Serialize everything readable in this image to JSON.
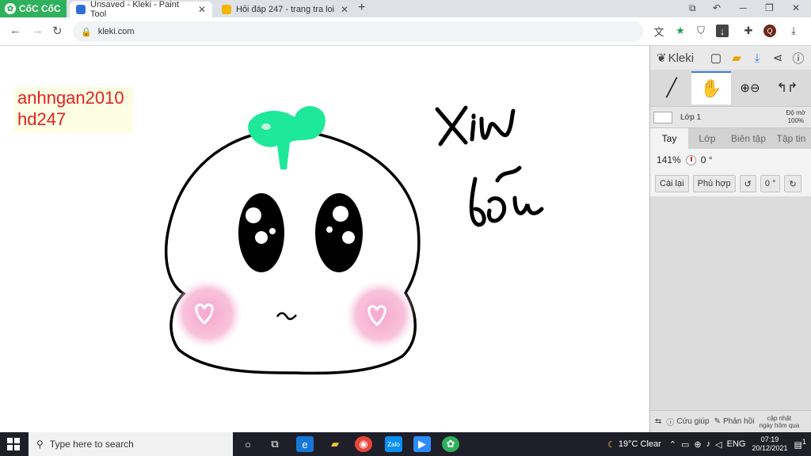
{
  "browser": {
    "brand_name": "CốC CốC",
    "tabs": [
      {
        "title": "Unsaved - Kleki - Paint Tool",
        "active": true
      },
      {
        "title": "Hỏi đáp 247 - trang tra loi",
        "active": false
      }
    ],
    "url": "kleki.com"
  },
  "canvas": {
    "note_line1": "anhngan2010",
    "note_line2": "hd247",
    "colors": {
      "sprout": "#1ee89a",
      "note_text": "#e02323",
      "note_bg": "#fdfde3",
      "blush": "#f6b3d3"
    }
  },
  "kleki": {
    "logo_text": "Kleki",
    "layer_name": "Lớp 1",
    "opacity_label_line1": "Độ mờ",
    "opacity_label_line2": "100%",
    "tabs": [
      "Tay",
      "Lớp",
      "Biên tập",
      "Tập tin"
    ],
    "zoom": "141%",
    "rotation": "0 °",
    "buttons": {
      "reset": "Cài lại",
      "fit": "Phù hợp",
      "angle": "0 °"
    },
    "bottom": {
      "help": "Cứu giúp",
      "feedback": "Phản hồi",
      "update_line1": "cập nhật",
      "update_line2": "ngày hôm qua"
    },
    "accent": "#3d7fe0"
  },
  "taskbar": {
    "search_placeholder": "Type here to search",
    "weather": "19°C  Clear",
    "language": "ENG",
    "time": "07:19",
    "date": "20/12/2021",
    "notification_count": "1"
  }
}
